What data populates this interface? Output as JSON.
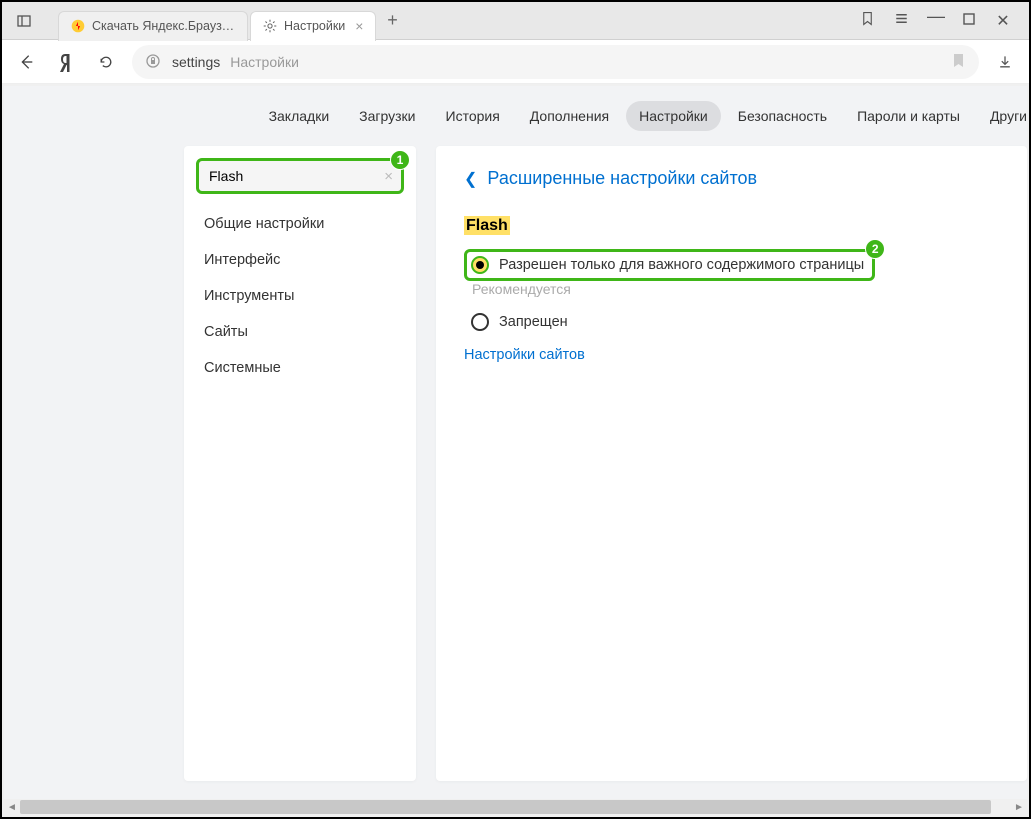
{
  "window": {
    "tabs": [
      {
        "title": "Скачать Яндекс.Браузер д",
        "favicon": "yandex"
      },
      {
        "title": "Настройки",
        "favicon": "gear"
      }
    ]
  },
  "address": {
    "host": "settings",
    "path": "Настройки"
  },
  "topnav": {
    "items": [
      "Закладки",
      "Загрузки",
      "История",
      "Дополнения",
      "Настройки",
      "Безопасность",
      "Пароли и карты",
      "Други"
    ],
    "active_index": 4
  },
  "sidebar": {
    "search_value": "Flash",
    "items": [
      "Общие настройки",
      "Интерфейс",
      "Инструменты",
      "Сайты",
      "Системные"
    ]
  },
  "main": {
    "breadcrumb": "Расширенные настройки сайтов",
    "section_title": "Flash",
    "options": [
      {
        "label": "Разрешен только для важного содержимого страницы",
        "selected": true,
        "recommended": "Рекомендуется"
      },
      {
        "label": "Запрещен",
        "selected": false
      }
    ],
    "link": "Настройки сайтов"
  },
  "annotations": {
    "badge1": "1",
    "badge2": "2"
  }
}
